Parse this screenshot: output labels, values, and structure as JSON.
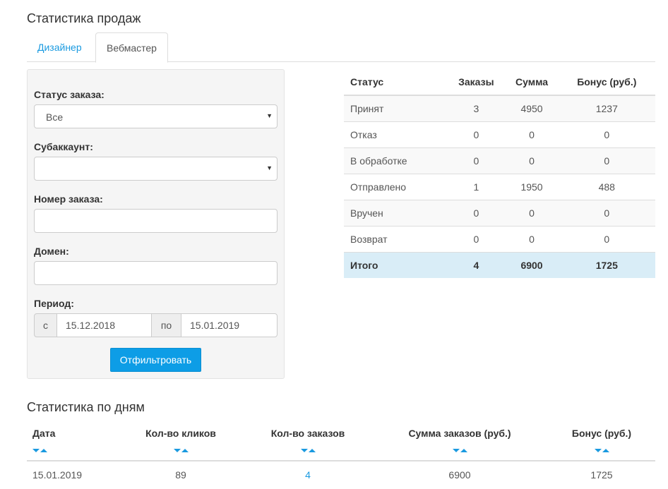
{
  "page_title": "Статистика продаж",
  "tabs": [
    {
      "label": "Дизайнер",
      "active": false
    },
    {
      "label": "Вебмастер",
      "active": true
    }
  ],
  "filter": {
    "status_label": "Статус заказа:",
    "status_value": "Все",
    "subaccount_label": "Субаккаунт:",
    "subaccount_value": "",
    "order_number_label": "Номер заказа:",
    "order_number_value": "",
    "domain_label": "Домен:",
    "domain_value": "",
    "period_label": "Период:",
    "period_from_addon": "с",
    "period_from": "15.12.2018",
    "period_to_addon": "по",
    "period_to": "15.01.2019",
    "submit_label": "Отфильтровать"
  },
  "status_table": {
    "headers": [
      "Статус",
      "Заказы",
      "Сумма",
      "Бонус (руб.)"
    ],
    "rows": [
      [
        "Принят",
        "3",
        "4950",
        "1237"
      ],
      [
        "Отказ",
        "0",
        "0",
        "0"
      ],
      [
        "В обработке",
        "0",
        "0",
        "0"
      ],
      [
        "Отправлено",
        "1",
        "1950",
        "488"
      ],
      [
        "Вручен",
        "0",
        "0",
        "0"
      ],
      [
        "Возврат",
        "0",
        "0",
        "0"
      ]
    ],
    "total": [
      "Итого",
      "4",
      "6900",
      "1725"
    ]
  },
  "days_title": "Статистика по дням",
  "days_table": {
    "headers": [
      "Дата",
      "Кол-во кликов",
      "Кол-во заказов",
      "Сумма заказов (руб.)",
      "Бонус (руб.)"
    ],
    "rows": [
      [
        "15.01.2019",
        "89",
        "4",
        "6900",
        "1725"
      ]
    ]
  },
  "colors": {
    "accent": "#1a9ae0",
    "button": "#0d9de6",
    "total_row": "#d9edf7"
  }
}
